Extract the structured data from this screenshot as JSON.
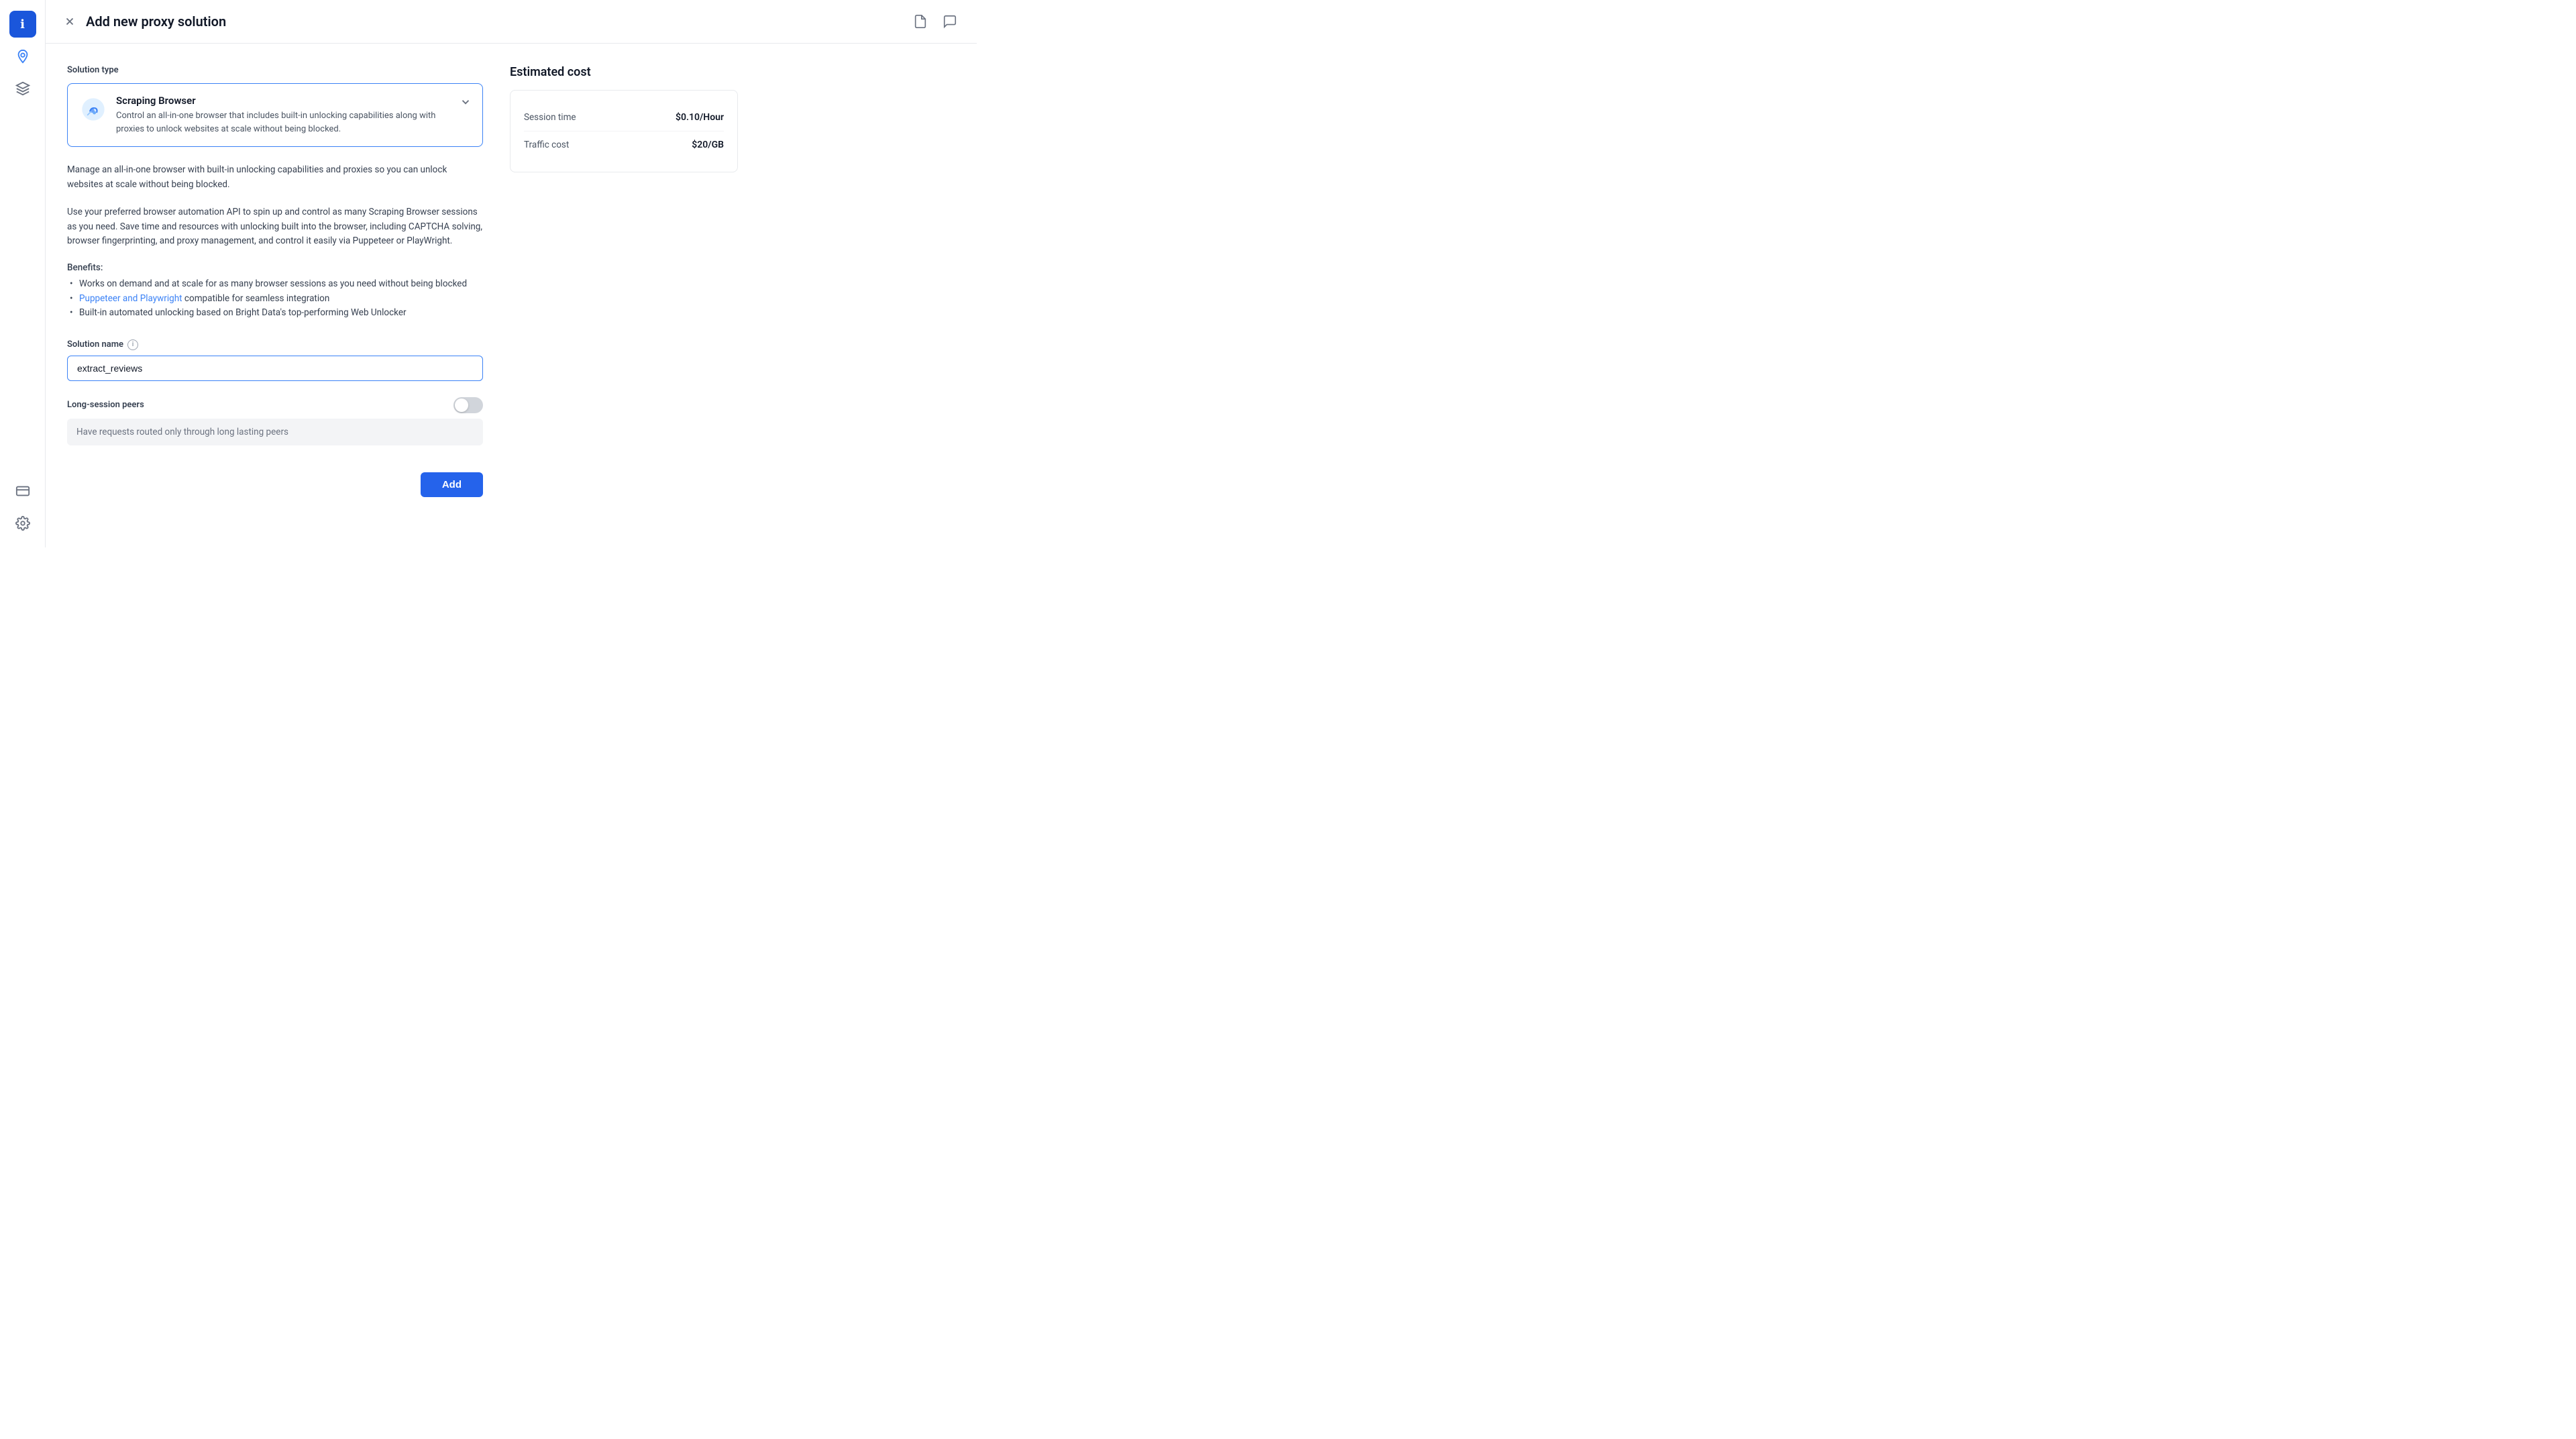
{
  "sidebar": {
    "icons": [
      {
        "name": "info-icon",
        "symbol": "ℹ",
        "active": true,
        "nav_active": false
      },
      {
        "name": "location-icon",
        "symbol": "◎",
        "active": false,
        "nav_active": true
      },
      {
        "name": "layers-icon",
        "symbol": "⊞",
        "active": false,
        "nav_active": false
      }
    ],
    "bottom_icons": [
      {
        "name": "billing-icon",
        "symbol": "▭"
      },
      {
        "name": "settings-icon",
        "symbol": "⚙"
      }
    ]
  },
  "header": {
    "title": "Add new proxy solution",
    "close_label": "×",
    "doc_icon": "doc",
    "chat_icon": "chat"
  },
  "solution_type": {
    "label": "Solution type",
    "selected_name": "Scraping Browser",
    "selected_desc": "Control an all-in-one browser that includes built-in unlocking capabilities along with proxies to unlock websites at scale without being blocked."
  },
  "description": {
    "para1": "Manage an all-in-one browser with built-in unlocking capabilities and proxies so you can unlock websites at scale without being blocked.",
    "para2": "Use your preferred browser automation API to spin up and control as many Scraping Browser sessions as you need. Save time and resources with unlocking built into the browser, including CAPTCHA solving, browser fingerprinting, and proxy management, and control it easily via Puppeteer or PlayWright.",
    "benefits_label": "Benefits:",
    "benefits": [
      {
        "text": "Works on demand and at scale for as many browser sessions as you need without being blocked",
        "link": null
      },
      {
        "text": "compatible for seamless integration",
        "link_text": "Puppeteer and Playwright",
        "has_link": true
      },
      {
        "text": "Built-in automated unlocking based on Bright Data's top-performing Web Unlocker",
        "link": null
      }
    ]
  },
  "solution_name": {
    "label": "Solution name",
    "value": "extract_reviews",
    "info_tooltip": "Solution name info"
  },
  "long_session_peers": {
    "label": "Long-session peers",
    "description": "Have requests routed only through long lasting peers",
    "toggle_on": false
  },
  "add_button": {
    "label": "Add"
  },
  "estimated_cost": {
    "title": "Estimated cost",
    "rows": [
      {
        "label": "Session time",
        "value": "$0.10/Hour"
      },
      {
        "label": "Traffic cost",
        "value": "$20/GB"
      }
    ]
  }
}
